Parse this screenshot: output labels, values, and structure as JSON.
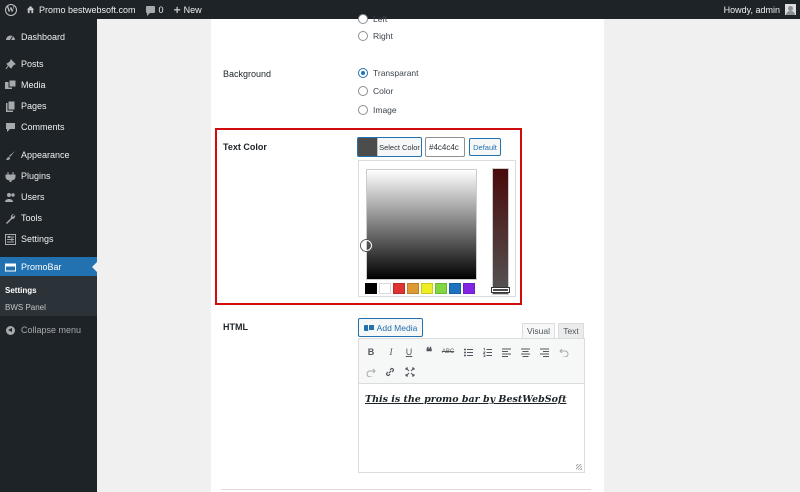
{
  "adminbar": {
    "site_name": "Promo bestwebsoft.com",
    "comments_count": "0",
    "new_label": "New",
    "greeting": "Howdy, admin"
  },
  "sidebar": {
    "items": [
      {
        "label": "Dashboard",
        "icon": "dashboard-icon"
      },
      {
        "label": "Posts",
        "icon": "pin-icon"
      },
      {
        "label": "Media",
        "icon": "media-icon"
      },
      {
        "label": "Pages",
        "icon": "pages-icon"
      },
      {
        "label": "Comments",
        "icon": "comment-icon"
      },
      {
        "label": "Appearance",
        "icon": "brush-icon"
      },
      {
        "label": "Plugins",
        "icon": "plug-icon"
      },
      {
        "label": "Users",
        "icon": "users-icon"
      },
      {
        "label": "Tools",
        "icon": "wrench-icon"
      },
      {
        "label": "Settings",
        "icon": "settings-icon"
      },
      {
        "label": "PromoBar",
        "icon": "promobar-icon"
      }
    ],
    "submenu": [
      {
        "label": "Settings"
      },
      {
        "label": "BWS Panel"
      }
    ],
    "collapse_label": "Collapse menu"
  },
  "position": {
    "options": [
      "Left",
      "Right"
    ]
  },
  "background": {
    "label": "Background",
    "options": [
      "Transparant",
      "Color",
      "Image"
    ],
    "selected": "Transparant"
  },
  "text_color": {
    "label": "Text Color",
    "select_label": "Select Color",
    "value": "#4c4c4c",
    "default_label": "Default",
    "palette": [
      "#000000",
      "#ffffff",
      "#dd3333",
      "#dd9933",
      "#eeee22",
      "#81d742",
      "#1e73be",
      "#8224e3"
    ]
  },
  "html_field": {
    "label": "HTML",
    "add_media_label": "Add Media",
    "tabs": [
      "Visual",
      "Text"
    ],
    "content": "This is the promo bar by BestWebSoft"
  },
  "colors": {
    "admin_bg": "#1d2327",
    "accent": "#2271b1",
    "highlight": "#d00d0d"
  }
}
